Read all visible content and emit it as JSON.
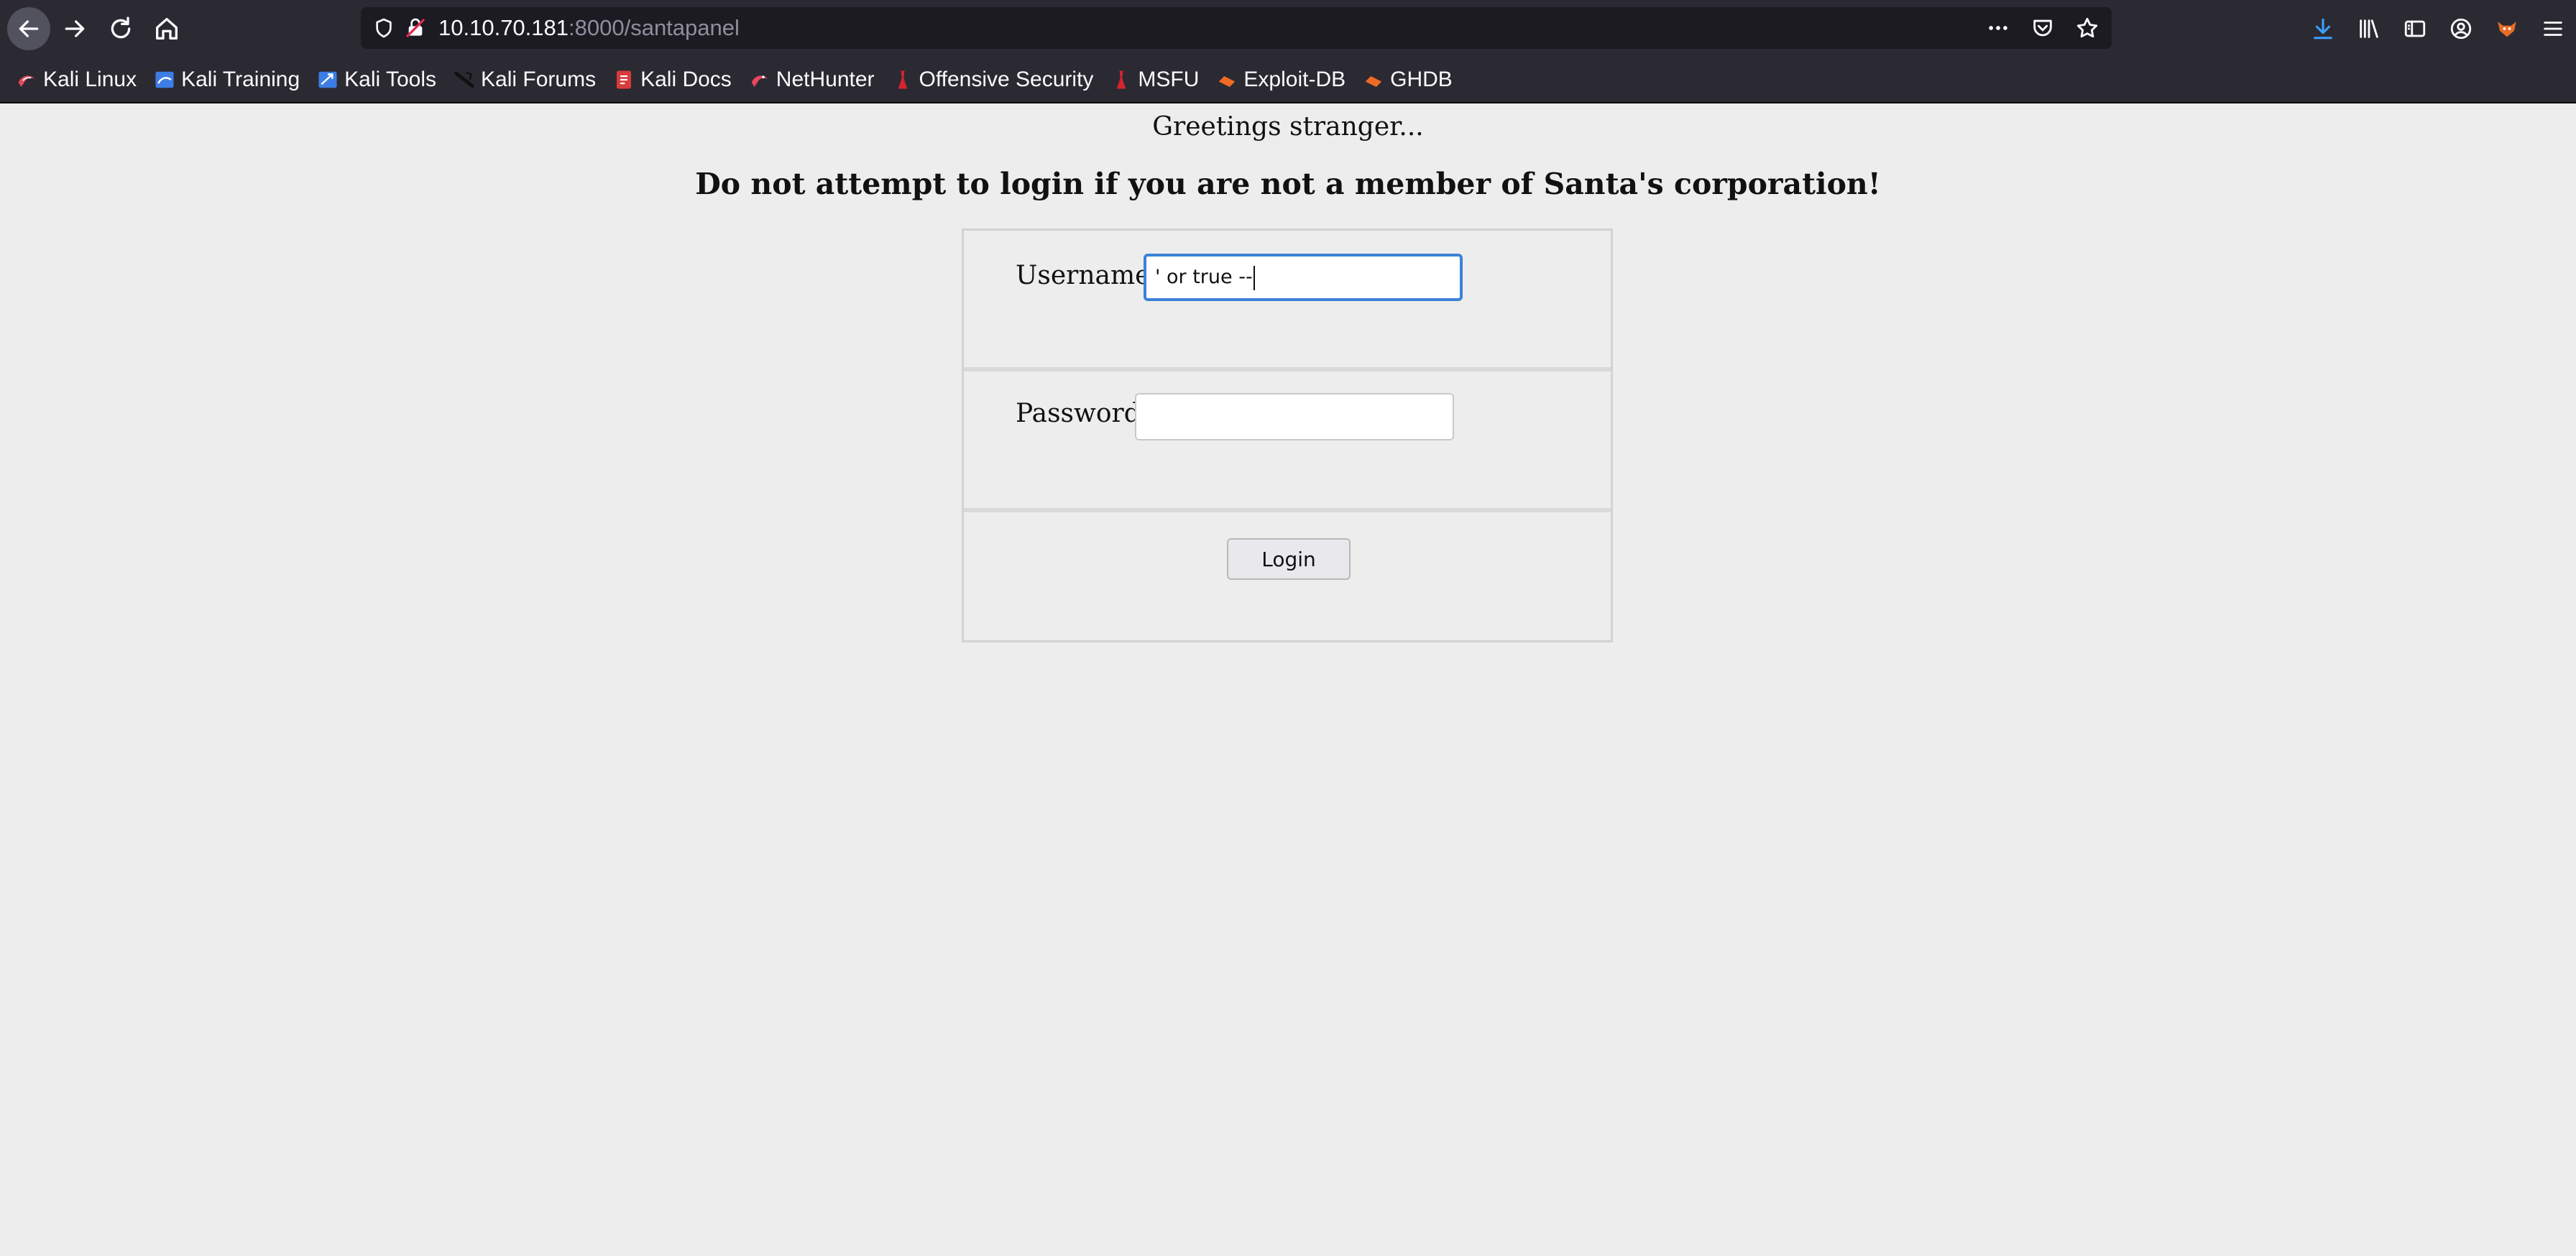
{
  "browser": {
    "url_host": "10.10.70.181",
    "url_rest": ":8000/santapanel",
    "bookmarks": [
      {
        "label": "Kali Linux",
        "icon": "kali-dragon-icon",
        "color": "#e8475f"
      },
      {
        "label": "Kali Training",
        "icon": "kali-training-icon",
        "color": "#3d7ee6"
      },
      {
        "label": "Kali Tools",
        "icon": "kali-tools-icon",
        "color": "#3d7ee6"
      },
      {
        "label": "Kali Forums",
        "icon": "kali-forums-icon",
        "color": "#111111"
      },
      {
        "label": "Kali Docs",
        "icon": "kali-docs-icon",
        "color": "#d93b3b"
      },
      {
        "label": "NetHunter",
        "icon": "nethunter-icon",
        "color": "#e8475f"
      },
      {
        "label": "Offensive Security",
        "icon": "offsec-icon",
        "color": "#d4252f"
      },
      {
        "label": "MSFU",
        "icon": "msfu-icon",
        "color": "#d4252f"
      },
      {
        "label": "Exploit-DB",
        "icon": "exploit-db-icon",
        "color": "#ef6b25"
      },
      {
        "label": "GHDB",
        "icon": "ghdb-icon",
        "color": "#ef6b25"
      }
    ]
  },
  "page": {
    "greeting": "Greetings stranger...",
    "warning": "Do not attempt to login if you are not a member of Santa's corporation!",
    "form": {
      "username_label": "Username",
      "username_value": "' or true --",
      "password_label": "Password",
      "password_value": "",
      "login_label": "Login"
    }
  }
}
